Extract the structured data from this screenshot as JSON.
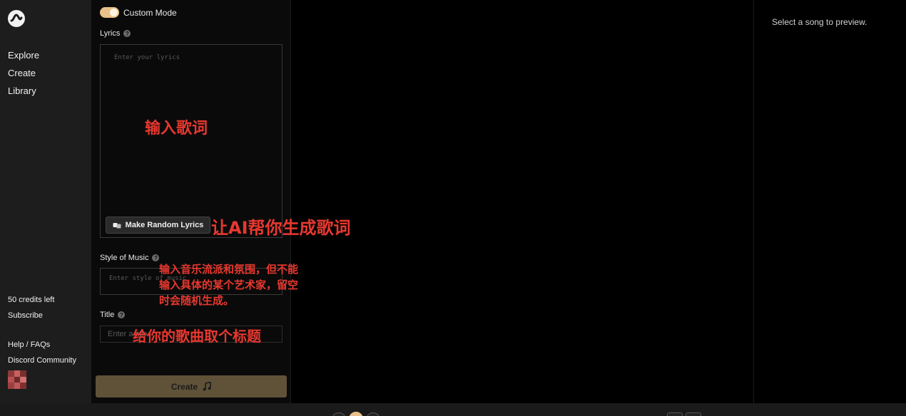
{
  "sidebar": {
    "nav": [
      {
        "label": "Explore"
      },
      {
        "label": "Create"
      },
      {
        "label": "Library"
      }
    ],
    "credits": "50 credits left",
    "subscribe": "Subscribe",
    "help": "Help / FAQs",
    "discord": "Discord Community"
  },
  "form": {
    "custom_mode_label": "Custom Mode",
    "custom_mode_on": true,
    "lyrics_label": "Lyrics",
    "lyrics_placeholder": "Enter your lyrics",
    "random_lyrics_label": "Make Random Lyrics",
    "style_label": "Style of Music",
    "style_placeholder": "Enter style of music",
    "title_label": "Title",
    "title_placeholder": "Enter a title",
    "create_label": "Create"
  },
  "preview": {
    "empty_text": "Select a song to preview."
  },
  "annotations": {
    "lyrics": "输入歌词",
    "ai_lyrics": "让AI帮你生成歌词",
    "style_line1": "输入音乐流派和氛围，但不能",
    "style_line2": "输入具体的某个艺术家，留空",
    "style_line3": "时会随机生成。",
    "title": "给你的歌曲取个标题"
  },
  "colors": {
    "accent": "#e8c08a",
    "create_button": "#5f5238",
    "annotation": "#e8382f",
    "sidebar_bg": "#1d1d1d"
  }
}
